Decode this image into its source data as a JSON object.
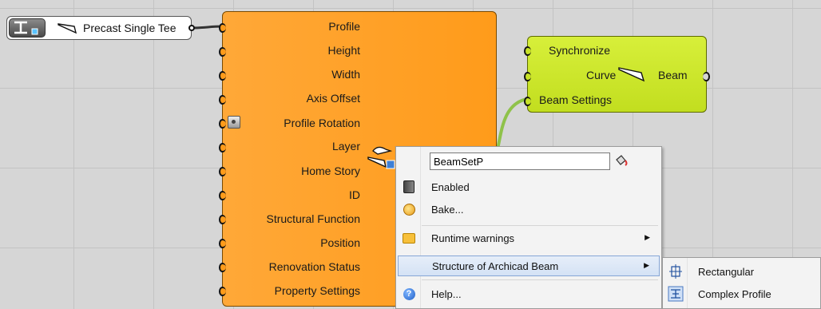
{
  "panel": {
    "label": "Precast Single Tee"
  },
  "beam_component": {
    "inputs": [
      "Profile",
      "Height",
      "Width",
      "Axis Offset",
      "Profile Rotation",
      "Layer",
      "Home Story",
      "ID",
      "Structural Function",
      "Position",
      "Renovation Status",
      "Property Settings"
    ]
  },
  "settings_component": {
    "inputs": [
      "Synchronize",
      "Curve",
      "Beam Settings"
    ],
    "output": "Beam"
  },
  "context_menu": {
    "name_value": "BeamSetP",
    "items": {
      "enabled": "Enabled",
      "bake": "Bake...",
      "runtime_warnings": "Runtime warnings",
      "structure": "Structure of Archicad Beam",
      "help": "Help..."
    }
  },
  "submenu": {
    "items": [
      "Rectangular",
      "Complex Profile"
    ]
  },
  "colors": {
    "component_orange": "#ff9b1a",
    "component_green": "#c2de1f",
    "menu_highlight": "#d4e2f5",
    "canvas": "#d6d6d6"
  }
}
